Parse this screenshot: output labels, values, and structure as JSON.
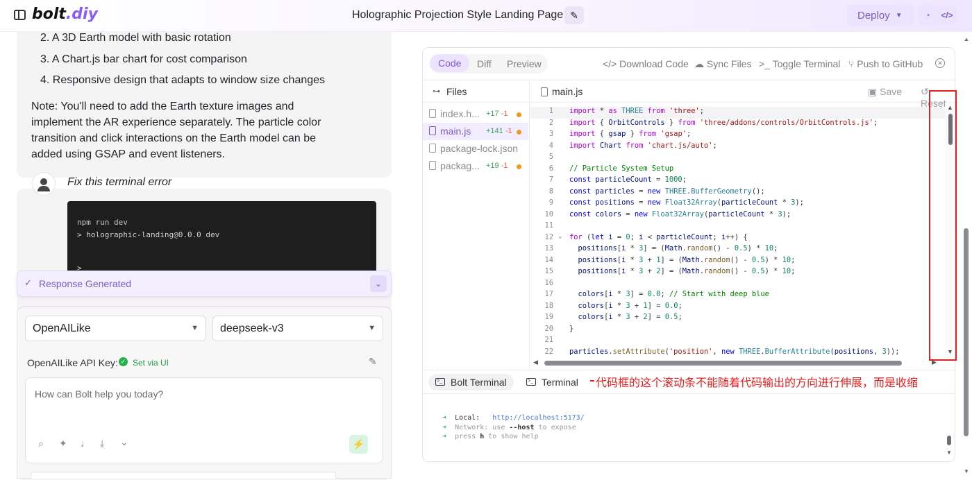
{
  "header": {
    "logo_main": "bolt",
    "logo_suffix": ".diy",
    "title": "Holographic Projection Style Landing Page",
    "deploy_label": "Deploy"
  },
  "chat": {
    "list_items": [
      "2. A 3D Earth model with basic rotation",
      "3. A Chart.js bar chart for cost comparison",
      "4. Responsive design that adapts to window size changes"
    ],
    "note": "Note: You'll need to add the Earth texture images and implement the AR experience separately. The particle color transition and click interactions on the Earth model can be added using GSAP and event listeners.",
    "user_message": "Fix this terminal error",
    "terminal_lines": [
      "npm run dev",
      "> holographic-landing@0.0.0 dev",
      ">"
    ],
    "response_status": "Response Generated"
  },
  "input": {
    "provider": "OpenAILike",
    "model": "deepseek-v3",
    "api_key_label": "OpenAILike API Key:",
    "api_key_status": "Set via UI",
    "placeholder": "How can Bolt help you today?"
  },
  "workbench": {
    "tabs": [
      "Code",
      "Diff",
      "Preview"
    ],
    "active_tab": "Code",
    "actions": [
      "Download Code",
      "Sync Files",
      "Toggle Terminal",
      "Push to GitHub"
    ],
    "files_title": "Files",
    "files": [
      {
        "name": "index.h...",
        "added": "+17",
        "removed": "-1",
        "modified": true,
        "selected": false
      },
      {
        "name": "main.js",
        "added": "+141",
        "removed": "-1",
        "modified": true,
        "selected": true
      },
      {
        "name": "package-lock.json",
        "added": "",
        "removed": "",
        "modified": false,
        "selected": false
      },
      {
        "name": "packag...",
        "added": "+19",
        "removed": "-1",
        "modified": true,
        "selected": false
      }
    ],
    "editor": {
      "filename": "main.js",
      "save_label": "Save",
      "reset_label": "Reset"
    },
    "terminal_tabs": [
      "Bolt Terminal",
      "Terminal"
    ],
    "terminal_output": {
      "local_label": "Local:",
      "local_url": "http://localhost:5173/",
      "network_label": "Network:",
      "network_text_1": "use",
      "network_flag": "--host",
      "network_text_2": "to expose",
      "help_text_1": "press",
      "help_key": "h",
      "help_text_2": "to show help"
    }
  },
  "code_lines": [
    "1",
    "2",
    "3",
    "4",
    "5",
    "6",
    "7",
    "8",
    "9",
    "10",
    "11",
    "12",
    "13",
    "14",
    "15",
    "16",
    "17",
    "18",
    "19",
    "20",
    "21",
    "22"
  ],
  "annotation": "代码框的这个滚动条不能随着代码输出的方向进行伸展，而是收缩",
  "colors": {
    "accent": "#7c5ac8",
    "annotation_red": "#e02020",
    "added_green": "#3aa559",
    "removed_red": "#e0634a",
    "modified_dot": "#f29a19"
  }
}
